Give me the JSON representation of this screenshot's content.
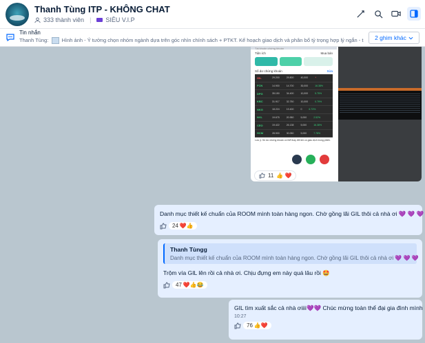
{
  "header": {
    "title": "Thanh Tùng ITP - KHÔNG CHAT",
    "members": "333 thành viên",
    "tag": "SIÊU V.I.P"
  },
  "pinned": {
    "title": "Tin nhắn",
    "sender": "Thanh Tùng:",
    "text": "Hình ảnh - Ý tưởng chọn nhóm ngành dựa trên góc nhìn chính sách + PTKT. Kế hoạch giao dịch và phân bổ tỷ trọng hợp lý ngắn - trung hạn",
    "more_button": "2 ghim khác"
  },
  "image_message": {
    "phone": {
      "top_label": "Tài khoản chứng khoán",
      "tab_row_left": "Tiện ích",
      "tab_row_right": "Mua bán",
      "section_title": "Số dư chứng khoán",
      "section_action": "Sửa",
      "stocks": [
        {
          "symbol": "GIL",
          "col1": "29.200",
          "col2": "29.800",
          "qty": "40,000",
          "pct": "+",
          "trend": "dn"
        },
        {
          "symbol": "FCN",
          "col1": "14.900",
          "col2": "14.700",
          "qty": "30,000",
          "pct": "16.38%",
          "trend": "up"
        },
        {
          "symbol": "DPG",
          "col1": "35.150",
          "col2": "34.400",
          "qty": "10,000",
          "pct": "5.75%",
          "trend": "up"
        },
        {
          "symbol": "KBC",
          "col1": "31.917",
          "col2": "32.750",
          "qty": "10,000",
          "pct": "0.79%",
          "trend": "up"
        },
        {
          "symbol": "NKG",
          "col1": "18.224",
          "col2": "19.400",
          "qty": "0",
          "pct": "6.73%",
          "trend": "up"
        },
        {
          "symbol": "NVL",
          "col1": "19.675",
          "col2": "20.950",
          "qty": "5,000",
          "pct": "2.52%",
          "trend": "up"
        },
        {
          "symbol": "CEO",
          "col1": "19.422",
          "col2": "26.138",
          "qty": "5,000",
          "pct": "16.38%",
          "trend": "up"
        },
        {
          "symbol": "HCM",
          "col1": "28.900",
          "col2": "30.050",
          "qty": "5,000",
          "pct": "7.78%",
          "trend": "up"
        }
      ],
      "footnote": "Lưu ý: Số dư chứng khoán có thể thay đổi khi có giao dịch trong phiên."
    },
    "reactions": {
      "count": "11",
      "icons": "👍 ❤️"
    }
  },
  "messages": [
    {
      "text": "Danh mục thiết kế chuẩn của ROOM mình toàn hàng ngon. Chờ gồng lãi GIL thôi cả nhà ơi 💜 💜 💜",
      "reactions": {
        "count": "24",
        "icons": "❤️👍"
      }
    },
    {
      "quote_name": "Thanh Tùngg",
      "quote_text": "Danh mục thiết kế chuẩn của ROOM mình toàn hàng ngon. Chờ gồng lãi GIL thôi cả nhà ơi 💜 💜 💜",
      "text": "Trộm vía GIL lên rồi cả nhà ơi. Chịu đựng em này quá lâu rồi 🤩",
      "reactions": {
        "count": "47",
        "icons": "❤️👍😂"
      }
    },
    {
      "text": "GIL tìm xuất sắc cả nhà ơiiii💜💜 Chúc mừng toàn thể đại gia đình mình",
      "time": "10:27",
      "reactions": {
        "count": "76",
        "icons": "👍❤️"
      }
    }
  ],
  "colors": {
    "accent": "#0068ff",
    "bubble": "#e5efff",
    "background": "#b9c6cf"
  }
}
